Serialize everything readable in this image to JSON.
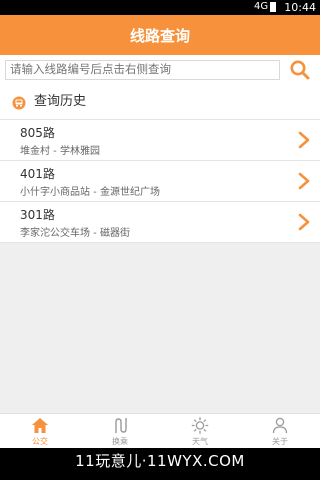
{
  "status_bar": {
    "signal": "4G",
    "time": "10:44"
  },
  "header": {
    "title": "线路查询"
  },
  "search": {
    "placeholder": "请输入线路编号后点击右侧查询"
  },
  "history": {
    "title": "查询历史",
    "items": [
      {
        "route": "805路",
        "stops": "堆金村 - 学林雅园"
      },
      {
        "route": "401路",
        "stops": "小什字小商品站 - 金源世纪广场"
      },
      {
        "route": "301路",
        "stops": "李家沱公交车场 - 磁器街"
      }
    ]
  },
  "bottom_nav": [
    {
      "label": "公交",
      "icon": "home-icon",
      "active": true
    },
    {
      "label": "换乘",
      "icon": "transfer-icon",
      "active": false
    },
    {
      "label": "天气",
      "icon": "sun-icon",
      "active": false
    },
    {
      "label": "关于",
      "icon": "person-icon",
      "active": false
    }
  ],
  "watermark": "11玩意儿·11WYX.COM",
  "colors": {
    "accent": "#f7913b",
    "background": "#efefef"
  }
}
